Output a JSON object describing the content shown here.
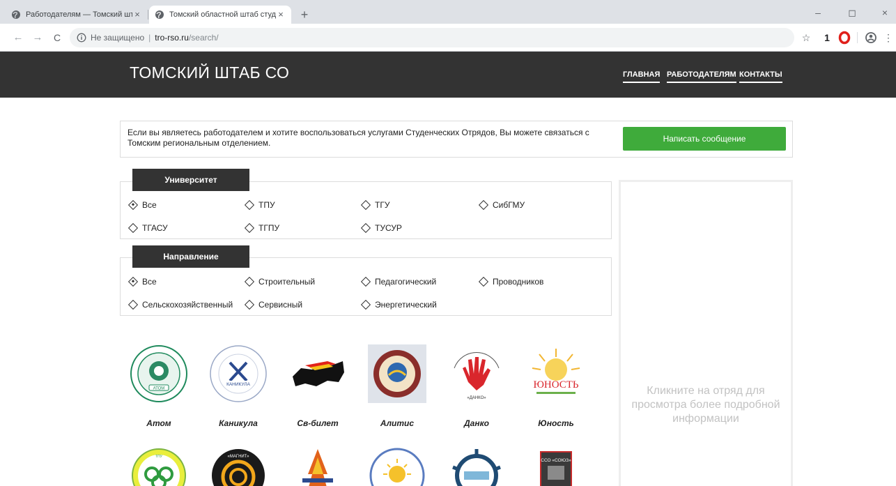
{
  "browser": {
    "tabs": [
      {
        "title": "Работодателям — Томский шта",
        "close": "×"
      },
      {
        "title": "Томский областной штаб студе",
        "close": "×"
      }
    ],
    "new_tab": "+",
    "window_controls": {
      "minimize": "–",
      "maximize": "◻",
      "close": "×"
    },
    "address": {
      "insecure_label": "Не защищено",
      "separator": "|",
      "host": "tro-rso.ru",
      "path": "/search/"
    },
    "nav_icons": {
      "back": "←",
      "forward": "→",
      "reload": "C"
    }
  },
  "site": {
    "logo": "ТОМСКИЙ ШТАБ СО",
    "nav": [
      "ГЛАВНАЯ",
      "РАБОТОДАТЕЛЯМ",
      "КОНТАКТЫ"
    ]
  },
  "notice": {
    "text": "Если вы являетесь работодателем и хотите воспользоваться услугами Студенческих Отрядов, Вы можете связаться с Томским региональным отделением.",
    "button": "Написать сообщение",
    "button_color": "#3fab3b"
  },
  "filters": {
    "university": {
      "label": "Университет",
      "options": [
        "Все",
        "ТПУ",
        "ТГУ",
        "СибГМУ",
        "ТГАСУ",
        "ТГПУ",
        "ТУСУР"
      ],
      "selected": "Все"
    },
    "direction": {
      "label": "Направление",
      "options": [
        "Все",
        "Строительный",
        "Педагогический",
        "Проводников",
        "Сельскохозяйственный",
        "Сервисный",
        "Энергетический"
      ],
      "selected": "Все"
    }
  },
  "squads": [
    {
      "name": "Атом",
      "logo_text": "АТОМ"
    },
    {
      "name": "Каникула",
      "logo_text": "КАНИКУЛА"
    },
    {
      "name": "Св-билет",
      "logo_text": ""
    },
    {
      "name": "Алитис",
      "logo_text": ""
    },
    {
      "name": "Данко",
      "logo_text": "«ДАНКО»"
    },
    {
      "name": "Юность",
      "logo_text": "ЮНОСТЬ"
    }
  ],
  "squads_row2": [
    {
      "logo_text": "ТПУ"
    },
    {
      "logo_text": "«МАГНИТ»"
    },
    {
      "logo_text": ""
    },
    {
      "logo_text": ""
    },
    {
      "logo_text": ""
    },
    {
      "logo_text": "ССО «СОЮЗ»"
    }
  ],
  "side_panel": {
    "hint": "Кликните на отряд для просмотра более подробной информации"
  },
  "colors": {
    "header_bg": "#333333",
    "accent_green": "#3fab3b",
    "hint_gray": "#c2c2c2"
  }
}
